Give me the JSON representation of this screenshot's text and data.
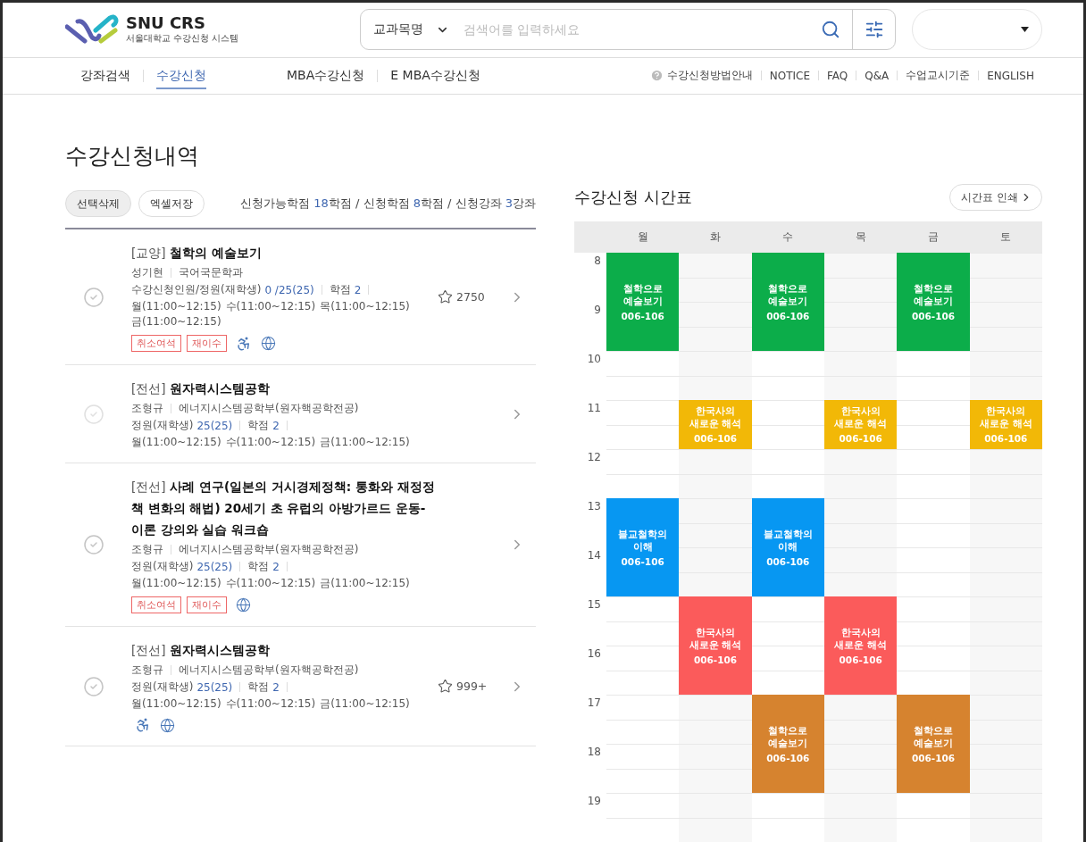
{
  "header": {
    "logo_title": "SNU CRS",
    "logo_subtitle": "서울대학교 수강신청 시스템",
    "search": {
      "scope": "교과목명",
      "placeholder": "검색어를 입력하세요"
    }
  },
  "nav": [
    {
      "label": "강좌검색",
      "selected": false
    },
    {
      "label": "수강신청",
      "selected": true
    },
    {
      "label": "MBA수강신청",
      "selected": false
    },
    {
      "label": "E MBA수강신청",
      "selected": false
    }
  ],
  "util_links": [
    "수강신청방법안내",
    "NOTICE",
    "FAQ",
    "Q&A",
    "수업교시기준",
    "ENGLISH"
  ],
  "page_title": "수강신청내역",
  "actions": [
    {
      "label": "선택삭제",
      "kind": "filled"
    },
    {
      "label": "엑셀저장",
      "kind": "outline"
    }
  ],
  "summary": [
    {
      "text": "신청가능학점 ",
      "kind": "text"
    },
    {
      "text": "18",
      "kind": "number"
    },
    {
      "text": "학점 / 신청학점 ",
      "kind": "text"
    },
    {
      "text": "8",
      "kind": "number"
    },
    {
      "text": "학점 / 신청강좌 ",
      "kind": "text"
    },
    {
      "text": "3",
      "kind": "number"
    },
    {
      "text": "강좌",
      "kind": "text"
    }
  ],
  "courses": [
    {
      "category": "[교양]",
      "title": "철학의 예술보기",
      "professor": "성기현",
      "department": "국어국문학과",
      "capacity_label": "수강신청인원/정원(재학생)",
      "capacity": "0 /25(25)",
      "credit_label": "학점",
      "credit": "2",
      "schedule": [
        "월(11:00~12:15)",
        "수(11:00~12:15)",
        "목(11:00~12:15)",
        "금(11:00~12:15)"
      ],
      "tags": [
        "취소여석",
        "재이수"
      ],
      "accessible": true,
      "global": true,
      "stars": "2750",
      "disabled": false
    },
    {
      "category": "[전선]",
      "title": "원자력시스템공학",
      "professor": "조형규",
      "department": "에너지시스템공학부(원자핵공학전공)",
      "capacity_label": "정원(재학생)",
      "capacity": "25(25)",
      "credit_label": "학점",
      "credit": "2",
      "schedule": [
        "월(11:00~12:15)",
        "수(11:00~12:15)",
        "금(11:00~12:15)"
      ],
      "accessible": false,
      "global": false,
      "disabled": true
    },
    {
      "category": "[전선]",
      "title": "사례 연구(일본의 거시경제정책: 통화와 재정정책 변화의 해법) 20세기 초 유럽의 아방가르드 운동- 이론 강의와 실습 워크숍",
      "professor": "조형규",
      "department": "에너지시스템공학부(원자핵공학전공)",
      "capacity_label": "정원(재학생)",
      "capacity": "25(25)",
      "credit_label": "학점",
      "credit": "2",
      "schedule": [
        "월(11:00~12:15)",
        "수(11:00~12:15)",
        "금(11:00~12:15)"
      ],
      "tags": [
        "취소여석",
        "재이수"
      ],
      "accessible": false,
      "global": true,
      "disabled": false
    },
    {
      "category": "[전선]",
      "title": "원자력시스템공학",
      "professor": "조형규",
      "department": "에너지시스템공학부(원자핵공학전공)",
      "capacity_label": "정원(재학생)",
      "capacity": "25(25)",
      "credit_label": "학점",
      "credit": "2",
      "schedule": [
        "월(11:00~12:15)",
        "수(11:00~12:15)",
        "금(11:00~12:15)"
      ],
      "accessible": true,
      "global": true,
      "stars": "999+",
      "disabled": false
    }
  ],
  "timetable": {
    "title": "수강신청 시간표",
    "print_button": "시간표 인쇄",
    "hours": [
      "8",
      "9",
      "10",
      "11",
      "12",
      "13",
      "14",
      "15",
      "16",
      "17",
      "18",
      "19"
    ],
    "days": [
      {
        "label": "월",
        "slots": [
          {
            "kind": "class",
            "title": "철학으로 예술보기",
            "room": "006-106",
            "color": "#0cad4a"
          },
          {
            "kind": "continued"
          },
          {
            "kind": "empty"
          },
          {
            "kind": "empty"
          },
          {
            "kind": "empty"
          },
          {
            "kind": "class",
            "title": "블교철학의 이해",
            "room": "006-106",
            "color": "#0797f2"
          },
          {
            "kind": "continued"
          }
        ]
      },
      {
        "label": "화",
        "slots": [
          {
            "kind": "empty"
          },
          {
            "kind": "empty"
          },
          {
            "kind": "empty"
          },
          {
            "kind": "class",
            "title": "한국사의 새로운 해석",
            "room": "006-106",
            "color": "#f2b807"
          },
          {
            "kind": "empty"
          },
          {
            "kind": "empty"
          },
          {
            "kind": "empty"
          },
          {
            "kind": "class",
            "title": "한국사의 새로운 해석",
            "room": "006-106",
            "color": "#fb5b5b"
          },
          {
            "kind": "continued"
          }
        ]
      },
      {
        "label": "수",
        "slots": [
          {
            "kind": "class",
            "title": "철학으로 예술보기",
            "room": "006-106",
            "color": "#0cad4a"
          },
          {
            "kind": "continued"
          },
          {
            "kind": "empty"
          },
          {
            "kind": "empty"
          },
          {
            "kind": "empty"
          },
          {
            "kind": "class",
            "title": "블교철학의 이해",
            "room": "006-106",
            "color": "#0797f2"
          },
          {
            "kind": "continued"
          },
          {
            "kind": "empty"
          },
          {
            "kind": "empty"
          },
          {
            "kind": "class",
            "title": "철학으로 예술보기",
            "room": "006-106",
            "color": "#d6832f"
          },
          {
            "kind": "continued"
          }
        ]
      },
      {
        "label": "목",
        "slots": [
          {
            "kind": "empty"
          },
          {
            "kind": "empty"
          },
          {
            "kind": "empty"
          },
          {
            "kind": "class",
            "title": "한국사의 새로운 해석",
            "room": "006-106",
            "color": "#f2b807"
          },
          {
            "kind": "empty"
          },
          {
            "kind": "empty"
          },
          {
            "kind": "empty"
          },
          {
            "kind": "class",
            "title": "한국사의 새로운 해석",
            "room": "006-106",
            "color": "#fb5b5b"
          },
          {
            "kind": "continued"
          }
        ]
      },
      {
        "label": "금",
        "slots": [
          {
            "kind": "class",
            "title": "철학으로 예술보기",
            "room": "006-106",
            "color": "#0cad4a"
          },
          {
            "kind": "continued"
          },
          {
            "kind": "empty"
          },
          {
            "kind": "empty"
          },
          {
            "kind": "empty"
          },
          {
            "kind": "empty"
          },
          {
            "kind": "empty"
          },
          {
            "kind": "empty"
          },
          {
            "kind": "empty"
          },
          {
            "kind": "class",
            "title": "철학으로 예술보기",
            "room": "006-106",
            "color": "#d6832f"
          },
          {
            "kind": "continued"
          }
        ]
      },
      {
        "label": "토",
        "slots": [
          {
            "kind": "empty"
          },
          {
            "kind": "empty"
          },
          {
            "kind": "empty"
          },
          {
            "kind": "class",
            "title": "한국사의 새로운 해석",
            "room": "006-106",
            "color": "#f2b807"
          }
        ]
      }
    ]
  }
}
